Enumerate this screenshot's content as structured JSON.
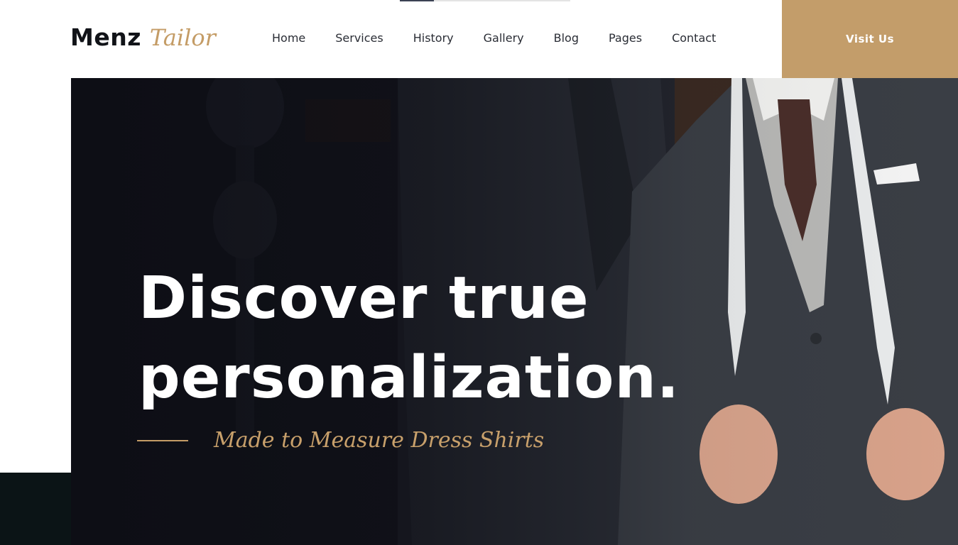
{
  "brand": {
    "name": "Menz",
    "script": "Tailor",
    "accent": "#c39d6a"
  },
  "top_progress": {
    "fraction": 0.2
  },
  "nav": {
    "items": [
      {
        "label": "Home"
      },
      {
        "label": "Services"
      },
      {
        "label": "History"
      },
      {
        "label": "Gallery"
      },
      {
        "label": "Blog"
      },
      {
        "label": "Pages"
      },
      {
        "label": "Contact"
      }
    ]
  },
  "cta": {
    "label": "Visit Us"
  },
  "hero": {
    "headline_line1": "Discover true",
    "headline_line2": "personalization.",
    "subtitle": "Made to Measure Dress Shirts",
    "image": "tailor-with-measuring-tape"
  },
  "colors": {
    "dark_block": "#0b1416",
    "text_dark": "#111318",
    "gold": "#c49c66"
  }
}
